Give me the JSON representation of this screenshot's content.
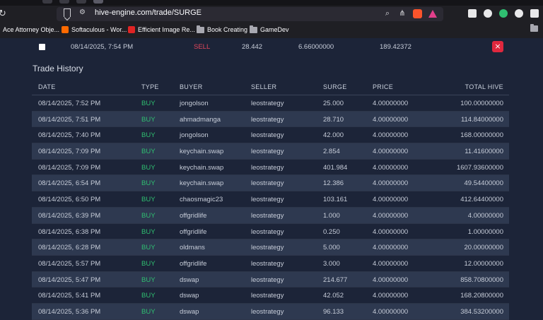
{
  "browser": {
    "url": "hive-engine.com/trade/SURGE",
    "bookmarks": [
      {
        "label": "Ace Attorney Obje...",
        "color": "#3a3a42"
      },
      {
        "label": "Softaculous - Wor...",
        "color": "#ff6a00"
      },
      {
        "label": "Efficient Image Re...",
        "color": "#e02424"
      },
      {
        "label": "Book Creating",
        "color": "#a8a8b0"
      },
      {
        "label": "GameDev",
        "color": "#a8a8b0"
      }
    ]
  },
  "open_order": {
    "date": "08/14/2025, 7:54 PM",
    "type": "SELL",
    "quantity": "28.442",
    "price": "6.66000000",
    "total": "189.42372",
    "cancel_label": "×"
  },
  "trade_history": {
    "title": "Trade History",
    "columns": [
      "DATE",
      "TYPE",
      "BUYER",
      "SELLER",
      "SURGE",
      "PRICE",
      "TOTAL HIVE"
    ],
    "rows": [
      [
        "08/14/2025, 7:52 PM",
        "BUY",
        "jongolson",
        "leostrategy",
        "25.000",
        "4.00000000",
        "100.00000000"
      ],
      [
        "08/14/2025, 7:51 PM",
        "BUY",
        "ahmadmanga",
        "leostrategy",
        "28.710",
        "4.00000000",
        "114.84000000"
      ],
      [
        "08/14/2025, 7:40 PM",
        "BUY",
        "jongolson",
        "leostrategy",
        "42.000",
        "4.00000000",
        "168.00000000"
      ],
      [
        "08/14/2025, 7:09 PM",
        "BUY",
        "keychain.swap",
        "leostrategy",
        "2.854",
        "4.00000000",
        "11.41600000"
      ],
      [
        "08/14/2025, 7:09 PM",
        "BUY",
        "keychain.swap",
        "leostrategy",
        "401.984",
        "4.00000000",
        "1607.93600000"
      ],
      [
        "08/14/2025, 6:54 PM",
        "BUY",
        "keychain.swap",
        "leostrategy",
        "12.386",
        "4.00000000",
        "49.54400000"
      ],
      [
        "08/14/2025, 6:50 PM",
        "BUY",
        "chaosmagic23",
        "leostrategy",
        "103.161",
        "4.00000000",
        "412.64400000"
      ],
      [
        "08/14/2025, 6:39 PM",
        "BUY",
        "offgridlife",
        "leostrategy",
        "1.000",
        "4.00000000",
        "4.00000000"
      ],
      [
        "08/14/2025, 6:38 PM",
        "BUY",
        "offgridlife",
        "leostrategy",
        "0.250",
        "4.00000000",
        "1.00000000"
      ],
      [
        "08/14/2025, 6:28 PM",
        "BUY",
        "oldmans",
        "leostrategy",
        "5.000",
        "4.00000000",
        "20.00000000"
      ],
      [
        "08/14/2025, 5:57 PM",
        "BUY",
        "offgridlife",
        "leostrategy",
        "3.000",
        "4.00000000",
        "12.00000000"
      ],
      [
        "08/14/2025, 5:47 PM",
        "BUY",
        "dswap",
        "leostrategy",
        "214.677",
        "4.00000000",
        "858.70800000"
      ],
      [
        "08/14/2025, 5:41 PM",
        "BUY",
        "dswap",
        "leostrategy",
        "42.052",
        "4.00000000",
        "168.20800000"
      ],
      [
        "08/14/2025, 5:36 PM",
        "BUY",
        "dswap",
        "leostrategy",
        "96.133",
        "4.00000000",
        "384.53200000"
      ]
    ]
  }
}
